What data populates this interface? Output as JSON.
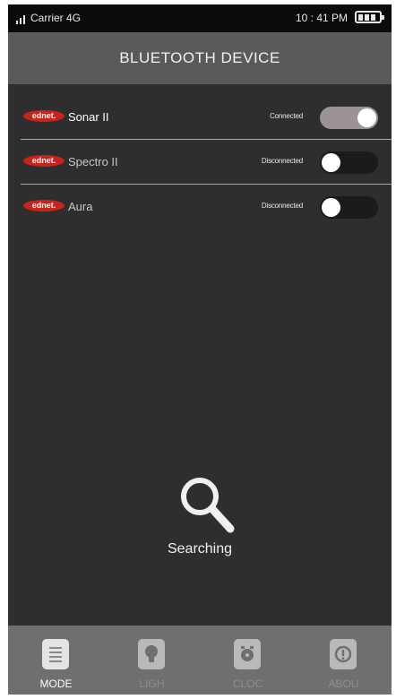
{
  "status_bar": {
    "carrier": "Carrier 4G",
    "time": "10 : 41 PM"
  },
  "header": {
    "title": "BLUETOOTH DEVICE"
  },
  "devices": [
    {
      "brand": "ednet.",
      "name": "Sonar II",
      "status": "Connected",
      "connected": true
    },
    {
      "brand": "ednet.",
      "name": "Spectro II",
      "status": "Disconnected",
      "connected": false
    },
    {
      "brand": "ednet.",
      "name": "Aura",
      "status": "Disconnected",
      "connected": false
    }
  ],
  "search": {
    "label": "Searching",
    "icon": "search-icon"
  },
  "tabs": [
    {
      "label": "MODE",
      "icon": "mode-icon",
      "active": true
    },
    {
      "label": "LIGH",
      "icon": "light-bulb-icon",
      "active": false
    },
    {
      "label": "CLOC",
      "icon": "clock-icon",
      "active": false
    },
    {
      "label": "ABOU",
      "icon": "info-icon",
      "active": false
    }
  ]
}
